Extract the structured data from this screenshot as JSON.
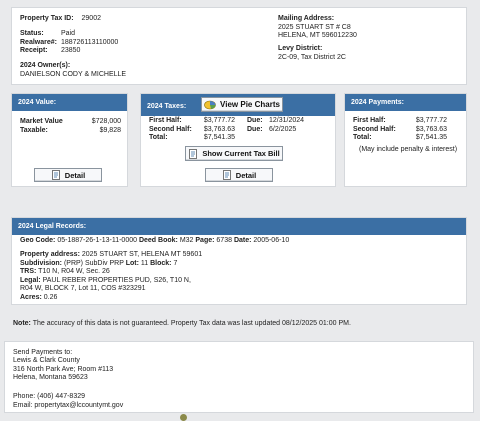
{
  "property": {
    "id_label": "Property Tax ID:",
    "id_value": "29002",
    "status_label": "Status:",
    "status_value": "Paid",
    "realware_label": "Realware#:",
    "realware_value": "188726113110000",
    "receipt_label": "Receipt:",
    "receipt_value": "23850",
    "owners_label": "2024 Owner(s):",
    "owners_value": "DANIELSON CODY & MICHELLE",
    "mailing_label": "Mailing Address:",
    "mailing_line1": "2025 STUART ST # C8",
    "mailing_line2": "HELENA, MT 596012230",
    "levy_label": "Levy District:",
    "levy_value": "2C-09, Tax District 2C"
  },
  "value_box": {
    "title": "2024 Value:",
    "market_label": "Market Value",
    "market_value": "$728,000",
    "taxable_label": "Taxable:",
    "taxable_value": "$9,828",
    "detail_label": "Detail"
  },
  "taxes_box": {
    "title": "2024 Taxes:",
    "pie_label": "View Pie Charts",
    "first_label": "First Half:",
    "first_value": "$3,777.72",
    "first_due_label": "Due:",
    "first_due": "12/31/2024",
    "second_label": "Second Half:",
    "second_value": "$3,763.63",
    "second_due_label": "Due:",
    "second_due": "6/2/2025",
    "total_label": "Total:",
    "total_value": "$7,541.35",
    "show_bill_label": "Show Current Tax Bill",
    "detail_label": "Detail"
  },
  "payments_box": {
    "title": "2024 Payments:",
    "first_label": "First Half:",
    "first_value": "$3,777.72",
    "second_label": "Second Half:",
    "second_value": "$3,763.63",
    "total_label": "Total:",
    "total_value": "$7,541.35",
    "note": "(May include penalty & interest)"
  },
  "legal": {
    "title": "2024 Legal Records:",
    "geo_label": "Geo Code:",
    "geo_value": "05-1887-26-1-13-11-0000",
    "deed_label": "Deed Book:",
    "deed_value": "M32",
    "page_label": "Page:",
    "page_value": "6738",
    "date_label": "Date:",
    "date_value": "2005-06-10",
    "addr_label": "Property address:",
    "addr_value": "2025 STUART ST, HELENA MT 59601",
    "subdiv_label": "Subdivision:",
    "subdiv_value": "(PRP) SubDiv PRP",
    "lot_label": "Lot:",
    "lot_value": "11",
    "block_label": "Block:",
    "block_value": "7",
    "trs_label": "TRS:",
    "trs_value": "T10 N, R04 W, Sec. 26",
    "legal_label": "Legal:",
    "legal_value1": "PAUL REBER PROPERTIES PUD, S26, T10 N,",
    "legal_value2": "R04 W, BLOCK 7, Lot 11, COS #323291",
    "acres_label": "Acres:",
    "acres_value": "0.26"
  },
  "note": {
    "label": "Note:",
    "text": "The accuracy of this data is not guaranteed. Property Tax data was last updated 08/12/2025 01:00 PM."
  },
  "footer": {
    "send": "Send Payments to:",
    "county": "Lewis & Clark County",
    "address": "316 North Park Ave; Room #113",
    "city": "Helena, Montana 59623",
    "phone": "Phone: (406) 447-8329",
    "email": "Email: propertytax@lccountymt.gov"
  },
  "colors": {
    "header_bar": "#3b6fa4",
    "background": "#e9eaec"
  }
}
